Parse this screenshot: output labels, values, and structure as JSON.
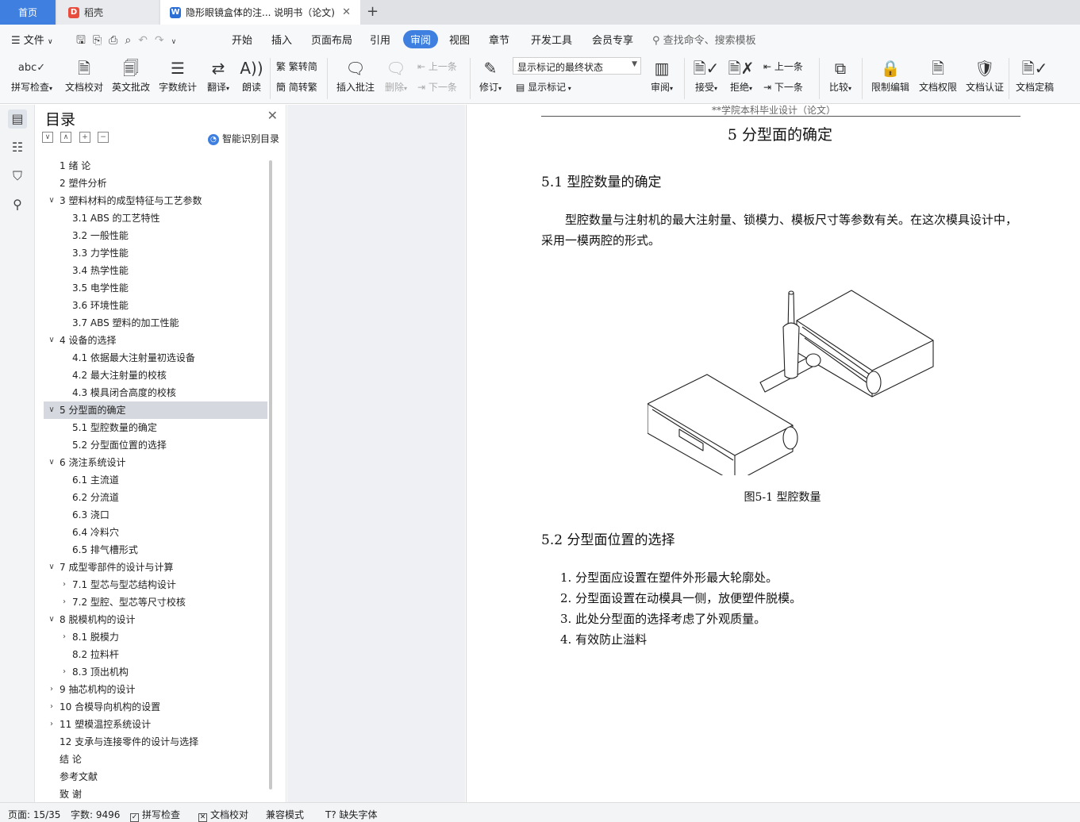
{
  "tabs": {
    "home": "首页",
    "daoke": "稻壳",
    "doc": "隐形眼镜盒体的注... 说明书（论文)"
  },
  "menu": {
    "file": "文件",
    "items": [
      "开始",
      "插入",
      "页面布局",
      "引用",
      "审阅",
      "视图",
      "章节",
      "开发工具",
      "会员专享"
    ],
    "search_placeholder": "查找命令、搜索模板"
  },
  "ribbon": {
    "spellcheck": "拼写检查",
    "doc_proof": "文档校对",
    "en_review": "英文批改",
    "word_count": "字数统计",
    "translate": "翻译",
    "read_aloud": "朗读",
    "to_traditional": "繁转简",
    "to_simplified": "简转繁",
    "insert_comment": "插入批注",
    "delete": "删除",
    "prev": "上一条",
    "next": "下一条",
    "track": "修订",
    "markup_state": "显示标记的最终状态",
    "show_markup": "显示标记",
    "review": "审阅",
    "accept": "接受",
    "reject": "拒绝",
    "prev2": "上一条",
    "next2": "下一条",
    "compare": "比较",
    "restrict": "限制编辑",
    "permission": "文档权限",
    "certify": "文档认证",
    "finalize": "文档定稿"
  },
  "toc": {
    "title": "目录",
    "smart": "智能识别目录",
    "items": [
      {
        "label": "1  绪  论",
        "level": 1,
        "chev": ""
      },
      {
        "label": "2  塑件分析",
        "level": 1,
        "chev": ""
      },
      {
        "label": "3  塑料材料的成型特征与工艺参数",
        "level": 1,
        "chev": "down"
      },
      {
        "label": "3.1 ABS 的工艺特性",
        "level": 2,
        "chev": ""
      },
      {
        "label": "3.2  一般性能",
        "level": 2,
        "chev": ""
      },
      {
        "label": "3.3  力学性能",
        "level": 2,
        "chev": ""
      },
      {
        "label": "3.4  热学性能",
        "level": 2,
        "chev": ""
      },
      {
        "label": "3.5  电学性能",
        "level": 2,
        "chev": ""
      },
      {
        "label": "3.6  环境性能",
        "level": 2,
        "chev": ""
      },
      {
        "label": "3.7 ABS 塑料的加工性能",
        "level": 2,
        "chev": ""
      },
      {
        "label": "4  设备的选择",
        "level": 1,
        "chev": "down"
      },
      {
        "label": "4.1  依据最大注射量初选设备",
        "level": 2,
        "chev": ""
      },
      {
        "label": "4.2  最大注射量的校核",
        "level": 2,
        "chev": ""
      },
      {
        "label": "4.3  模具闭合高度的校核",
        "level": 2,
        "chev": ""
      },
      {
        "label": "5  分型面的确定",
        "level": 1,
        "chev": "down",
        "selected": true
      },
      {
        "label": "5.1  型腔数量的确定",
        "level": 2,
        "chev": ""
      },
      {
        "label": "5.2  分型面位置的选择",
        "level": 2,
        "chev": ""
      },
      {
        "label": "6  浇注系统设计",
        "level": 1,
        "chev": "down"
      },
      {
        "label": "6.1  主流道",
        "level": 2,
        "chev": ""
      },
      {
        "label": "6.2  分流道",
        "level": 2,
        "chev": ""
      },
      {
        "label": "6.3  浇口",
        "level": 2,
        "chev": ""
      },
      {
        "label": "6.4  冷料穴",
        "level": 2,
        "chev": ""
      },
      {
        "label": "6.5  排气槽形式",
        "level": 2,
        "chev": ""
      },
      {
        "label": "7  成型零部件的设计与计算",
        "level": 1,
        "chev": "down"
      },
      {
        "label": "7.1  型芯与型芯结构设计",
        "level": 2,
        "chev": "right"
      },
      {
        "label": "7.2  型腔、型芯等尺寸校核",
        "level": 2,
        "chev": "right"
      },
      {
        "label": "8  脱模机构的设计",
        "level": 1,
        "chev": "down"
      },
      {
        "label": "8.1  脱模力",
        "level": 2,
        "chev": "right"
      },
      {
        "label": "8.2  拉料杆",
        "level": 2,
        "chev": ""
      },
      {
        "label": "8.3  顶出机构",
        "level": 2,
        "chev": "right"
      },
      {
        "label": "9  抽芯机构的设计",
        "level": 1,
        "chev": "right"
      },
      {
        "label": "10  合模导向机构的设置",
        "level": 1,
        "chev": "right"
      },
      {
        "label": "11  塑模温控系统设计",
        "level": 1,
        "chev": "right"
      },
      {
        "label": "12  支承与连接零件的设计与选择",
        "level": 1,
        "chev": ""
      },
      {
        "label": "结  论",
        "level": 1,
        "chev": ""
      },
      {
        "label": "参考文献",
        "level": 1,
        "chev": ""
      },
      {
        "label": "致  谢",
        "level": 1,
        "chev": ""
      }
    ]
  },
  "document": {
    "header": "**学院本科毕业设计（论文）",
    "chapter_title": "5  分型面的确定",
    "section1": "5.1  型腔数量的确定",
    "paragraph": "型腔数量与注射机的最大注射量、锁模力、模板尺寸等参数有关。在这次模具设计中，采用一模两腔的形式。",
    "figure_caption": "图5-1  型腔数量",
    "section2": "5.2  分型面位置的选择",
    "list": [
      "1.  分型面应设置在塑件外形最大轮廓处。",
      "2.  分型面设置在动模具一侧，放便塑件脱模。",
      "3.  此处分型面的选择考虑了外观质量。",
      "4.  有效防止溢料"
    ]
  },
  "status": {
    "page": "页面: 15/35",
    "words": "字数: 9496",
    "spell": "拼写检查",
    "proof": "文档校对",
    "compat": "兼容模式",
    "missing_font": "缺失字体"
  },
  "colors": {
    "accent": "#3f7fe0",
    "selected_row": "#d5d9df"
  }
}
